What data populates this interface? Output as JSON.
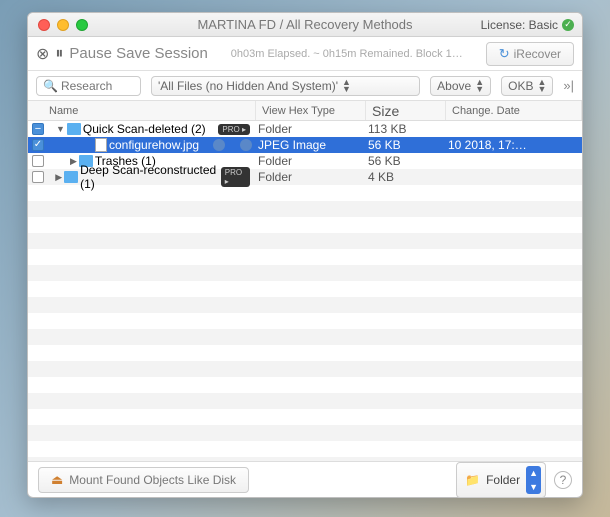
{
  "window": {
    "title": "MARTINA FD / All Recovery Methods",
    "license_label": "License: Basic"
  },
  "toolbar": {
    "pause_label": "Pause Save Session",
    "status": "0h03m Elapsed. ~ 0h15m Remained. Block 1…",
    "recover_label": "iRecover"
  },
  "filter": {
    "search_placeholder": "Research",
    "files_filter": "'All Files (no Hidden And System)'",
    "position_filter": "Above",
    "size_filter": "OKB"
  },
  "columns": {
    "name": "Name",
    "type": "View Hex Type",
    "size": "Size",
    "date": "Change. Date"
  },
  "rows": [
    {
      "check": "minus",
      "indent": 0,
      "disc": "▼",
      "icon": "folder",
      "label": "Quick Scan-deleted (2)",
      "pro": true,
      "type": "Folder",
      "size": "113 KB",
      "date": "",
      "sel": false
    },
    {
      "check": "check",
      "indent": 2,
      "disc": "",
      "icon": "file",
      "label": "configurehow.jpg",
      "pro": false,
      "dots": true,
      "type": "JPEG Image",
      "size": "56 KB",
      "date": "10 2018, 17:…",
      "sel": true
    },
    {
      "check": "none",
      "indent": 1,
      "disc": "▶",
      "icon": "folder",
      "label": "Trashes (1)",
      "pro": false,
      "type": "Folder",
      "size": "56 KB",
      "date": "",
      "sel": false
    },
    {
      "check": "none",
      "indent": 0,
      "disc": "▶",
      "icon": "folder",
      "label": "Deep Scan-reconstructed (1)",
      "pro": true,
      "type": "Folder",
      "size": "4 KB",
      "date": "",
      "sel": false
    }
  ],
  "footer": {
    "mount_label": "Mount Found Objects Like Disk",
    "folder_label": "Folder"
  }
}
